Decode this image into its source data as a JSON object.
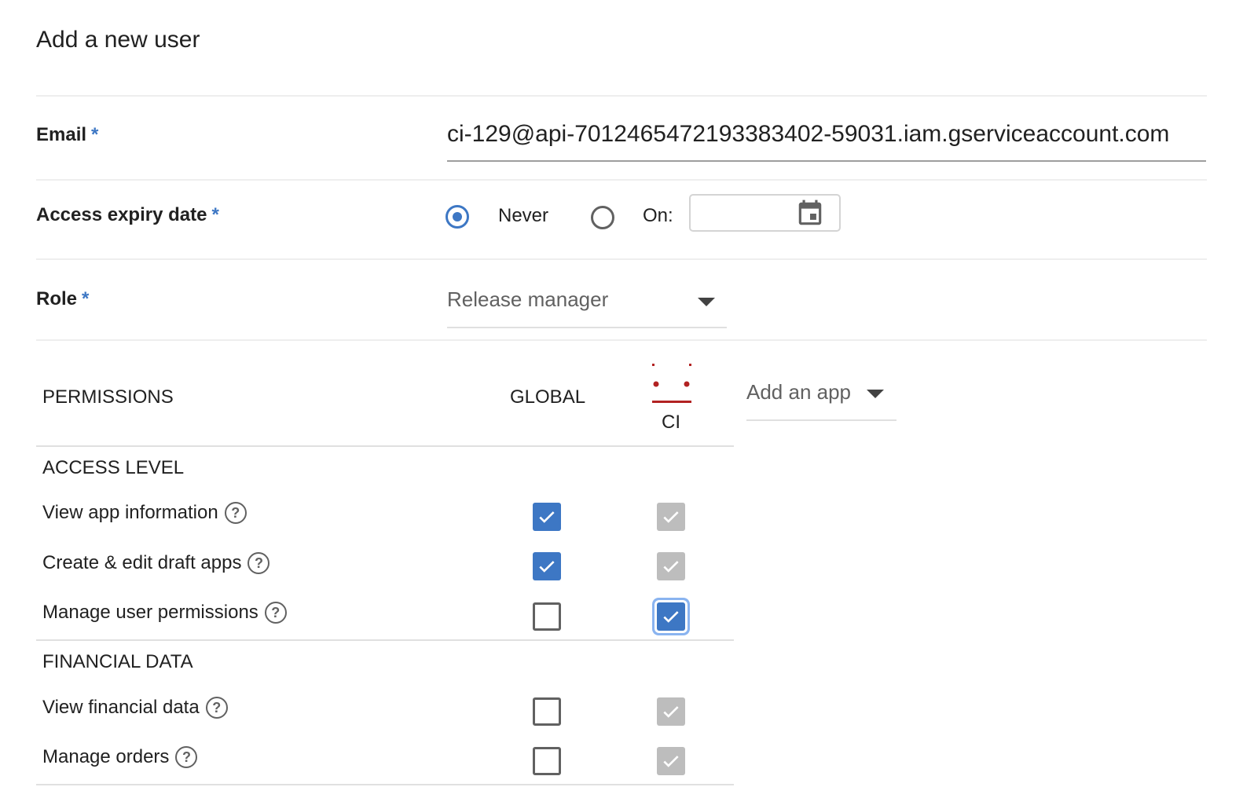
{
  "page": {
    "title": "Add a new user"
  },
  "form": {
    "email": {
      "label": "Email",
      "required_mark": "*",
      "value": "ci-129@api-7012465472193383402-59031.iam.gserviceaccount.com"
    },
    "access_expiry": {
      "label": "Access expiry date",
      "required_mark": "*",
      "options": [
        {
          "label": "Never",
          "selected": true
        },
        {
          "label": "On:",
          "selected": false
        }
      ],
      "date_value": ""
    },
    "role": {
      "label": "Role",
      "required_mark": "*",
      "value": "Release manager"
    }
  },
  "permissions": {
    "header": "PERMISSIONS",
    "columns": {
      "global": "GLOBAL",
      "app": "CI"
    },
    "add_app_label": "Add an app",
    "sections": [
      {
        "title": "ACCESS LEVEL",
        "rows": [
          {
            "label": "View app information",
            "global": "checked",
            "app": "disabled"
          },
          {
            "label": "Create & edit draft apps",
            "global": "checked",
            "app": "disabled"
          },
          {
            "label": "Manage user permissions",
            "global": "unchecked",
            "app": "focused-checked"
          }
        ]
      },
      {
        "title": "FINANCIAL DATA",
        "rows": [
          {
            "label": "View financial data",
            "global": "unchecked",
            "app": "disabled"
          },
          {
            "label": "Manage orders",
            "global": "unchecked",
            "app": "disabled"
          }
        ]
      }
    ]
  },
  "colors": {
    "accent": "#3d77c4",
    "disabled": "#bdbdbd",
    "text": "#212121",
    "divider": "#eeeeee"
  },
  "icons": {
    "help": "help-circle-icon",
    "calendar": "calendar-icon",
    "dropdown": "caret-down-icon",
    "check": "check-icon",
    "app": "app-logo-icon"
  }
}
